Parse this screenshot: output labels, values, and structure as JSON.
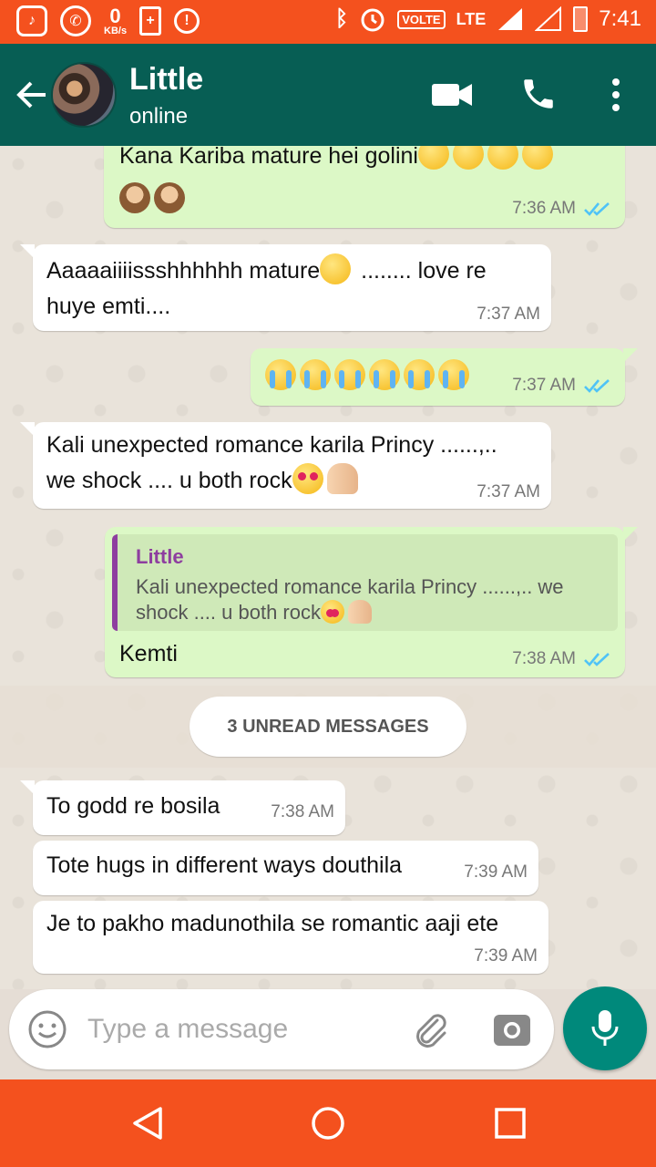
{
  "status_bar": {
    "kbs_value": "0",
    "kbs_unit": "KB/s",
    "volte": "VOLTE",
    "lte": "LTE",
    "time": "7:41",
    "icons": [
      "saavn-icon",
      "whatsapp-icon",
      "battery-plus-icon",
      "camera-alert-icon",
      "bluetooth-icon",
      "alarm-icon",
      "signal-icon",
      "battery-icon"
    ]
  },
  "header": {
    "contact_name": "Little",
    "contact_status": "online",
    "icons": [
      "back-arrow-icon",
      "video-call-icon",
      "phone-call-icon",
      "more-vert-icon"
    ]
  },
  "messages": [
    {
      "dir": "out",
      "text": "Kana Kariba mature hei golini",
      "text2": "",
      "time": "7:36 AM",
      "ticks": "read"
    },
    {
      "dir": "in",
      "text": "Aaaaaiiiissshhhhhh mature",
      "text_after": " ........ love re",
      "text2": "huye emti....",
      "time": "7:37 AM"
    },
    {
      "dir": "out",
      "text": "",
      "time": "7:37 AM",
      "ticks": "read"
    },
    {
      "dir": "in",
      "text": "Kali unexpected romance karila Princy ......,..",
      "text2": "we shock .... u both rock",
      "time": "7:37 AM"
    },
    {
      "dir": "out",
      "reply_to": {
        "name": "Little",
        "line1": "Kali unexpected romance karila Princy ......,.. we",
        "line2": "shock .... u both rock"
      },
      "text": "Kemti",
      "time": "7:38 AM",
      "ticks": "read"
    },
    {
      "dir": "in",
      "text": "To  godd re bosila",
      "time": "7:38 AM"
    },
    {
      "dir": "in",
      "text": "Tote hugs in different ways douthila",
      "time": "7:39 AM"
    },
    {
      "dir": "in",
      "text": "Je to pakho madunothila se romantic aaji ete",
      "time": "7:39 AM"
    }
  ],
  "unread_label": "3 UNREAD MESSAGES",
  "input": {
    "placeholder": "Type a message",
    "value": ""
  },
  "colors": {
    "status_bar": "#f4511e",
    "header": "#075e54",
    "outgoing_bubble": "#dcf8c6",
    "incoming_bubble": "#ffffff",
    "mic_button": "#00897b",
    "read_ticks": "#4fc3f7",
    "reply_accent": "#8e3e9f"
  }
}
